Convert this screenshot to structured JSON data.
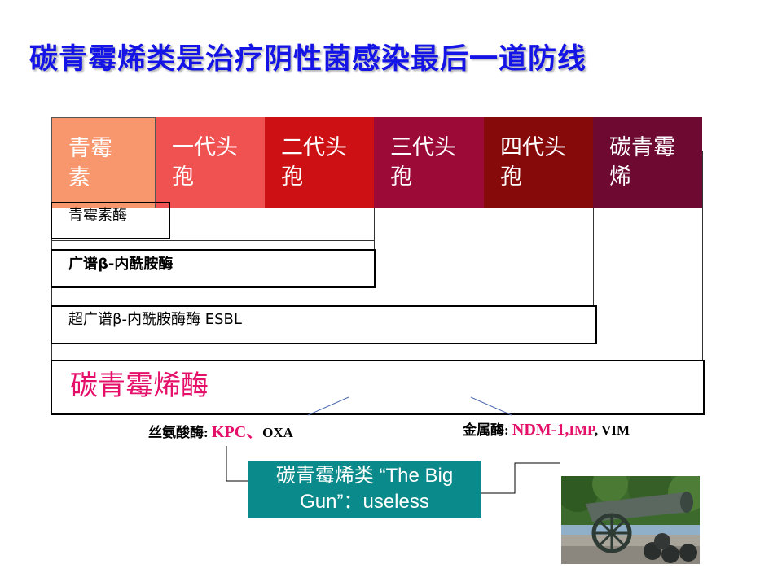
{
  "title": "碳青霉烯类是治疗阴性菌感染最后一道防线",
  "generations": [
    {
      "label": "青霉素",
      "color": "#f8976e"
    },
    {
      "label": "一代头孢",
      "color": "#f05252"
    },
    {
      "label": "二代头孢",
      "color": "#cc1014"
    },
    {
      "label": "三代头孢",
      "color": "#9c0a38"
    },
    {
      "label": "四代头孢",
      "color": "#860a0a"
    },
    {
      "label": "碳青霉烯",
      "color": "#6e0a32"
    }
  ],
  "enzymes": {
    "penicillinase": "青霉素酶",
    "broad_spectrum": "广谱β-内酰胺酶",
    "esbl": "超广谱β-内酰胺酶酶 ESBL",
    "carbapenemase": "碳青霉烯酶"
  },
  "serine": {
    "label": "丝氨酸酶:",
    "types": "KPC、",
    "types2": "OXA"
  },
  "metallo": {
    "label": "金属酶:",
    "ndm": "NDM-1,",
    "imp": "IMP",
    "rest": ", VIM"
  },
  "callout": {
    "line1": "碳青霉烯类 “The Big",
    "line2": "Gun”：useless"
  },
  "photo": {
    "subject": "cannon-photo"
  }
}
